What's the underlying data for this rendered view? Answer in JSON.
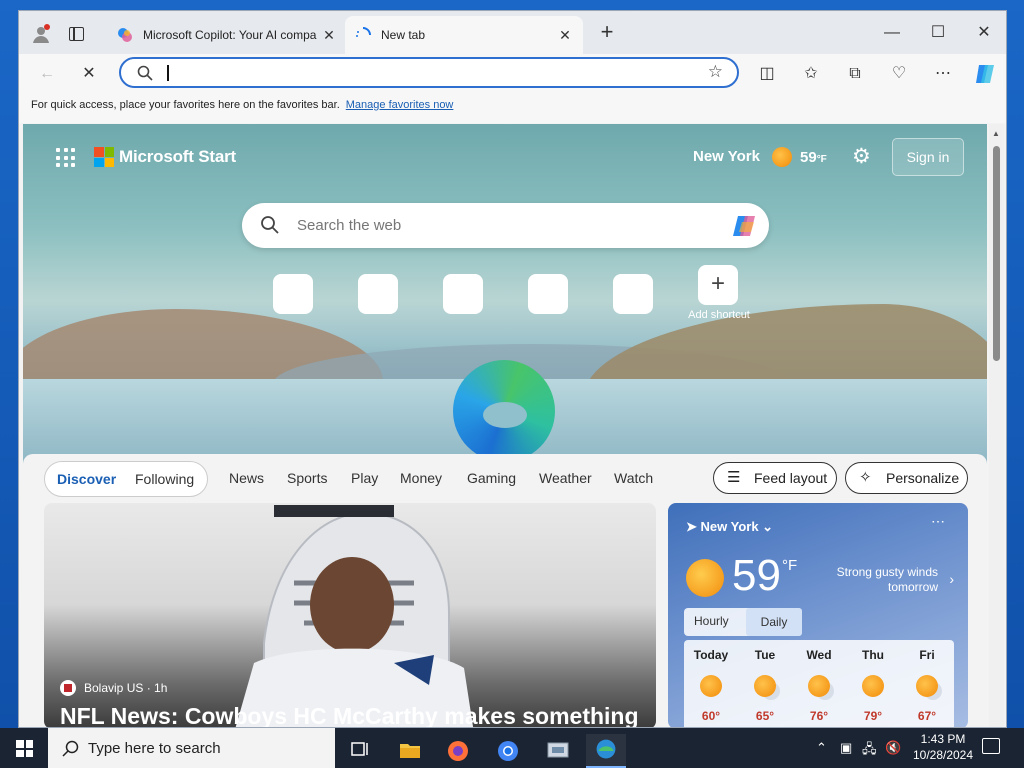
{
  "browser": {
    "tabs": [
      {
        "title": "Microsoft Copilot: Your AI compa",
        "active": false
      },
      {
        "title": "New tab",
        "active": true
      }
    ],
    "address_placeholder": "",
    "favorites_bar": {
      "message": "For quick access, place your favorites here on the favorites bar.",
      "link": "Manage favorites now"
    }
  },
  "start": {
    "brand": "Microsoft Start",
    "location": "New York",
    "temperature": "59",
    "temp_unit": "°F",
    "sign_in": "Sign in",
    "search_placeholder": "Search the web",
    "add_shortcut": "Add shortcut",
    "feed_tabs": [
      "Discover",
      "Following"
    ],
    "feed_nav": [
      "News",
      "Sports",
      "Play",
      "Money",
      "Gaming",
      "Weather",
      "Watch"
    ],
    "feed_layout": "Feed layout",
    "personalize": "Personalize"
  },
  "news": {
    "source": "Bolavip US",
    "age": "1h",
    "headline": "NFL News: Cowboys HC McCarthy makes something"
  },
  "weather": {
    "location": "New York",
    "temp": "59",
    "unit": "°F",
    "description": "Strong gusty winds tomorrow",
    "tabs": [
      "Hourly",
      "Daily"
    ],
    "selected_tab": "Daily",
    "days": [
      {
        "name": "Today",
        "temp": "60°",
        "icon": "sun-icon"
      },
      {
        "name": "Tue",
        "temp": "65°",
        "icon": "partly-cloudy-icon"
      },
      {
        "name": "Wed",
        "temp": "76°",
        "icon": "partly-cloudy-icon"
      },
      {
        "name": "Thu",
        "temp": "79°",
        "icon": "sun-icon"
      },
      {
        "name": "Fri",
        "temp": "67°",
        "icon": "partly-cloudy-icon"
      }
    ]
  },
  "taskbar": {
    "search_placeholder": "Type here to search",
    "time": "1:43 PM",
    "date": "10/28/2024"
  },
  "colors": {
    "accent": "#2f6fd0",
    "taskbar": "#1b2432",
    "temp_high": "#c0392b"
  }
}
